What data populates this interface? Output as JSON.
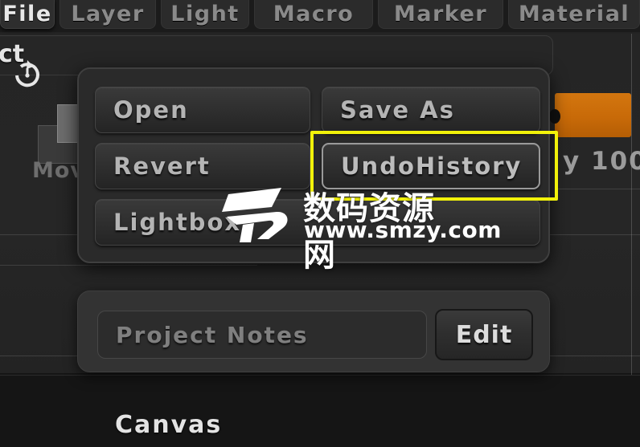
{
  "app": {
    "name": "ZBrush",
    "accent_orange": "#c86a08",
    "highlight_yellow": "#f2f20a",
    "panel_bg": "#2a2a2a",
    "text_muted": "#8a8a8a"
  },
  "menubar": {
    "tabs": [
      {
        "label": "File",
        "active": true
      },
      {
        "label": "Layer",
        "active": false
      },
      {
        "label": "Light",
        "active": false
      },
      {
        "label": "Macro",
        "active": false
      },
      {
        "label": "Marker",
        "active": false
      },
      {
        "label": "Material",
        "active": false
      }
    ]
  },
  "toolbar": {
    "project_label": "ct",
    "reset_icon": "rotate-reset-icon",
    "tool_name": "Move",
    "tool_icon": "move-tool-icon",
    "opacity_value": "y 100"
  },
  "file_menu": {
    "items": [
      {
        "label": "Open",
        "highlighted": false
      },
      {
        "label": "Save As",
        "highlighted": false
      },
      {
        "label": "Revert",
        "highlighted": false
      },
      {
        "label": "UndoHistory",
        "highlighted": true
      },
      {
        "label": "Lightbox",
        "highlighted": false
      }
    ],
    "highlighted_item": "UndoHistory"
  },
  "project_notes": {
    "placeholder": "Project Notes",
    "edit_label": "Edit"
  },
  "canvas": {
    "label": "Canvas"
  },
  "watermark": {
    "site_cn": "数码资源网",
    "url": "www.smzy.com",
    "logo": "smzy-logo-icon"
  }
}
